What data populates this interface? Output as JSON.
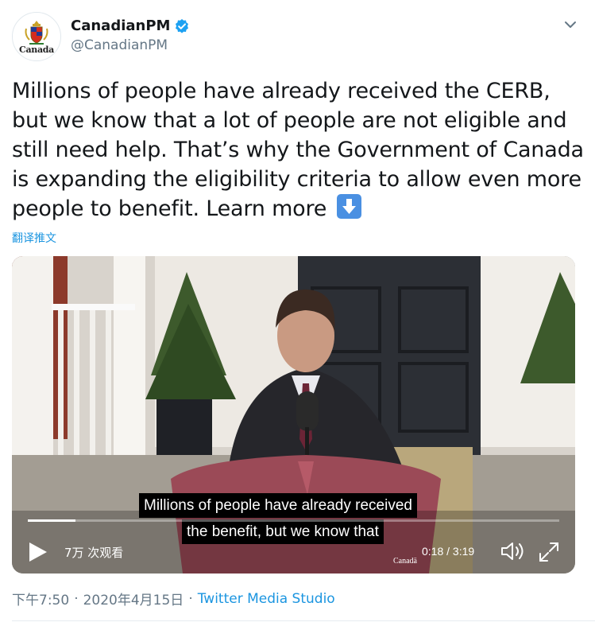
{
  "account": {
    "display_name": "CanadianPM",
    "handle": "@CanadianPM",
    "avatar_wordmark": "Canada",
    "verified": true
  },
  "tweet": {
    "text": "Millions of people have already received the CERB, but we know that a lot of people are not eligible and still need help. That’s why the Government of Canada is expanding the eligibility criteria to allow even more people to benefit. Learn more",
    "emoji": "down-arrow-button-icon",
    "translate_label": "翻译推文"
  },
  "video": {
    "subtitle_line1": "Millions of people have already received",
    "subtitle_line2": "the benefit, but we know that",
    "views_label": "7万 次观看",
    "time_label": "0:18 / 3:19",
    "progress": 0.09,
    "watermark": "Canadä"
  },
  "footer": {
    "time": "下午7:50",
    "separator": "·",
    "date": "2020年4月15日",
    "source": "Twitter Media Studio"
  },
  "colors": {
    "link": "#1b95e0",
    "secondary_text": "#657786",
    "verified": "#1da1f2",
    "emoji_bg": "#4a90e2"
  }
}
